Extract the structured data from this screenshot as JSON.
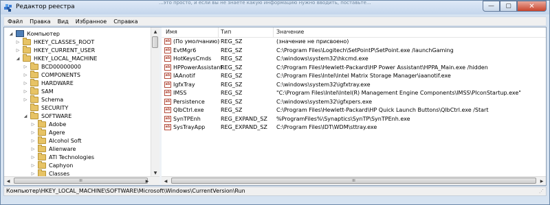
{
  "window": {
    "title": "Редактор реестра",
    "background_text": "...это просто, и если вы не знаете какую информацию нужно вводить, поставьте..."
  },
  "controls": {
    "minimize": "—",
    "maximize": "▢",
    "close": "✕"
  },
  "menu": [
    "Файл",
    "Правка",
    "Вид",
    "Избранное",
    "Справка"
  ],
  "tree": {
    "items": [
      {
        "label": "Компьютер",
        "expander": "◢",
        "icon": "computer-icon"
      },
      {
        "label": "HKEY_CLASSES_ROOT",
        "expander": "▷",
        "icon": "folder-icon"
      },
      {
        "label": "HKEY_CURRENT_USER",
        "expander": "▷",
        "icon": "folder-icon"
      },
      {
        "label": "HKEY_LOCAL_MACHINE",
        "expander": "◢",
        "icon": "folder-icon"
      },
      {
        "label": "BCD00000000",
        "expander": "▷",
        "icon": "folder-icon"
      },
      {
        "label": "COMPONENTS",
        "expander": "▷",
        "icon": "folder-icon"
      },
      {
        "label": "HARDWARE",
        "expander": "▷",
        "icon": "folder-icon"
      },
      {
        "label": "SAM",
        "expander": "▷",
        "icon": "folder-icon"
      },
      {
        "label": "Schema",
        "expander": "▷",
        "icon": "folder-icon"
      },
      {
        "label": "SECURITY",
        "expander": "",
        "icon": "folder-icon"
      },
      {
        "label": "SOFTWARE",
        "expander": "◢",
        "icon": "folder-icon"
      },
      {
        "label": "Adobe",
        "expander": "▷",
        "icon": "folder-icon"
      },
      {
        "label": "Agere",
        "expander": "▷",
        "icon": "folder-icon"
      },
      {
        "label": "Alcohol Soft",
        "expander": "▷",
        "icon": "folder-icon"
      },
      {
        "label": "Alienware",
        "expander": "▷",
        "icon": "folder-icon"
      },
      {
        "label": "ATI Technologies",
        "expander": "▷",
        "icon": "folder-icon"
      },
      {
        "label": "Caphyon",
        "expander": "▷",
        "icon": "folder-icon"
      },
      {
        "label": "Classes",
        "expander": "▷",
        "icon": "folder-icon"
      }
    ],
    "scroll_up": "▲",
    "scroll_down": "▼",
    "scroll_left": "◀",
    "scroll_right": "▶",
    "thumb_grip": "III"
  },
  "list": {
    "columns": [
      "Имя",
      "Тип",
      "Значение"
    ],
    "rows": [
      {
        "icon": "ab",
        "name": "(По умолчанию)",
        "type": "REG_SZ",
        "data": "(значение не присвоено)"
      },
      {
        "icon": "ab",
        "name": "EvtMgr6",
        "type": "REG_SZ",
        "data": "C:\\Program Files\\Logitech\\SetPointP\\SetPoint.exe /launchGaming"
      },
      {
        "icon": "ab",
        "name": "HotKeysCmds",
        "type": "REG_SZ",
        "data": "C:\\windows\\system32\\hkcmd.exe"
      },
      {
        "icon": "ab",
        "name": "HPPowerAssistant",
        "type": "REG_SZ",
        "data": "C:\\Program Files\\Hewlett-Packard\\HP Power Assistant\\HPPA_Main.exe /hidden"
      },
      {
        "icon": "ab",
        "name": "IAAnotif",
        "type": "REG_SZ",
        "data": "C:\\Program Files\\Intel\\Intel Matrix Storage Manager\\iaanotif.exe"
      },
      {
        "icon": "ab",
        "name": "IgfxTray",
        "type": "REG_SZ",
        "data": "C:\\windows\\system32\\igfxtray.exe"
      },
      {
        "icon": "ab",
        "name": "IMSS",
        "type": "REG_SZ",
        "data": "\"C:\\Program Files\\Intel\\Intel(R) Management Engine Components\\IMSS\\PIconStartup.exe\""
      },
      {
        "icon": "ab",
        "name": "Persistence",
        "type": "REG_SZ",
        "data": "C:\\windows\\system32\\igfxpers.exe"
      },
      {
        "icon": "ab",
        "name": "QlbCtrl.exe",
        "type": "REG_SZ",
        "data": "C:\\Program Files\\Hewlett-Packard\\HP Quick Launch Buttons\\QlbCtrl.exe /Start"
      },
      {
        "icon": "ab",
        "name": "SynTPEnh",
        "type": "REG_EXPAND_SZ",
        "data": "%ProgramFiles%\\Synaptics\\SynTP\\SynTPEnh.exe"
      },
      {
        "icon": "ab",
        "name": "SysTrayApp",
        "type": "REG_EXPAND_SZ",
        "data": "C:\\Program Files\\IDT\\WDM\\sttray.exe"
      }
    ],
    "scroll_left": "◀",
    "scroll_right": "▶",
    "thumb_grip": "III"
  },
  "status": {
    "path": "Компьютер\\HKEY_LOCAL_MACHINE\\SOFTWARE\\Microsoft\\Windows\\CurrentVersion\\Run",
    "grip": "⋰"
  }
}
